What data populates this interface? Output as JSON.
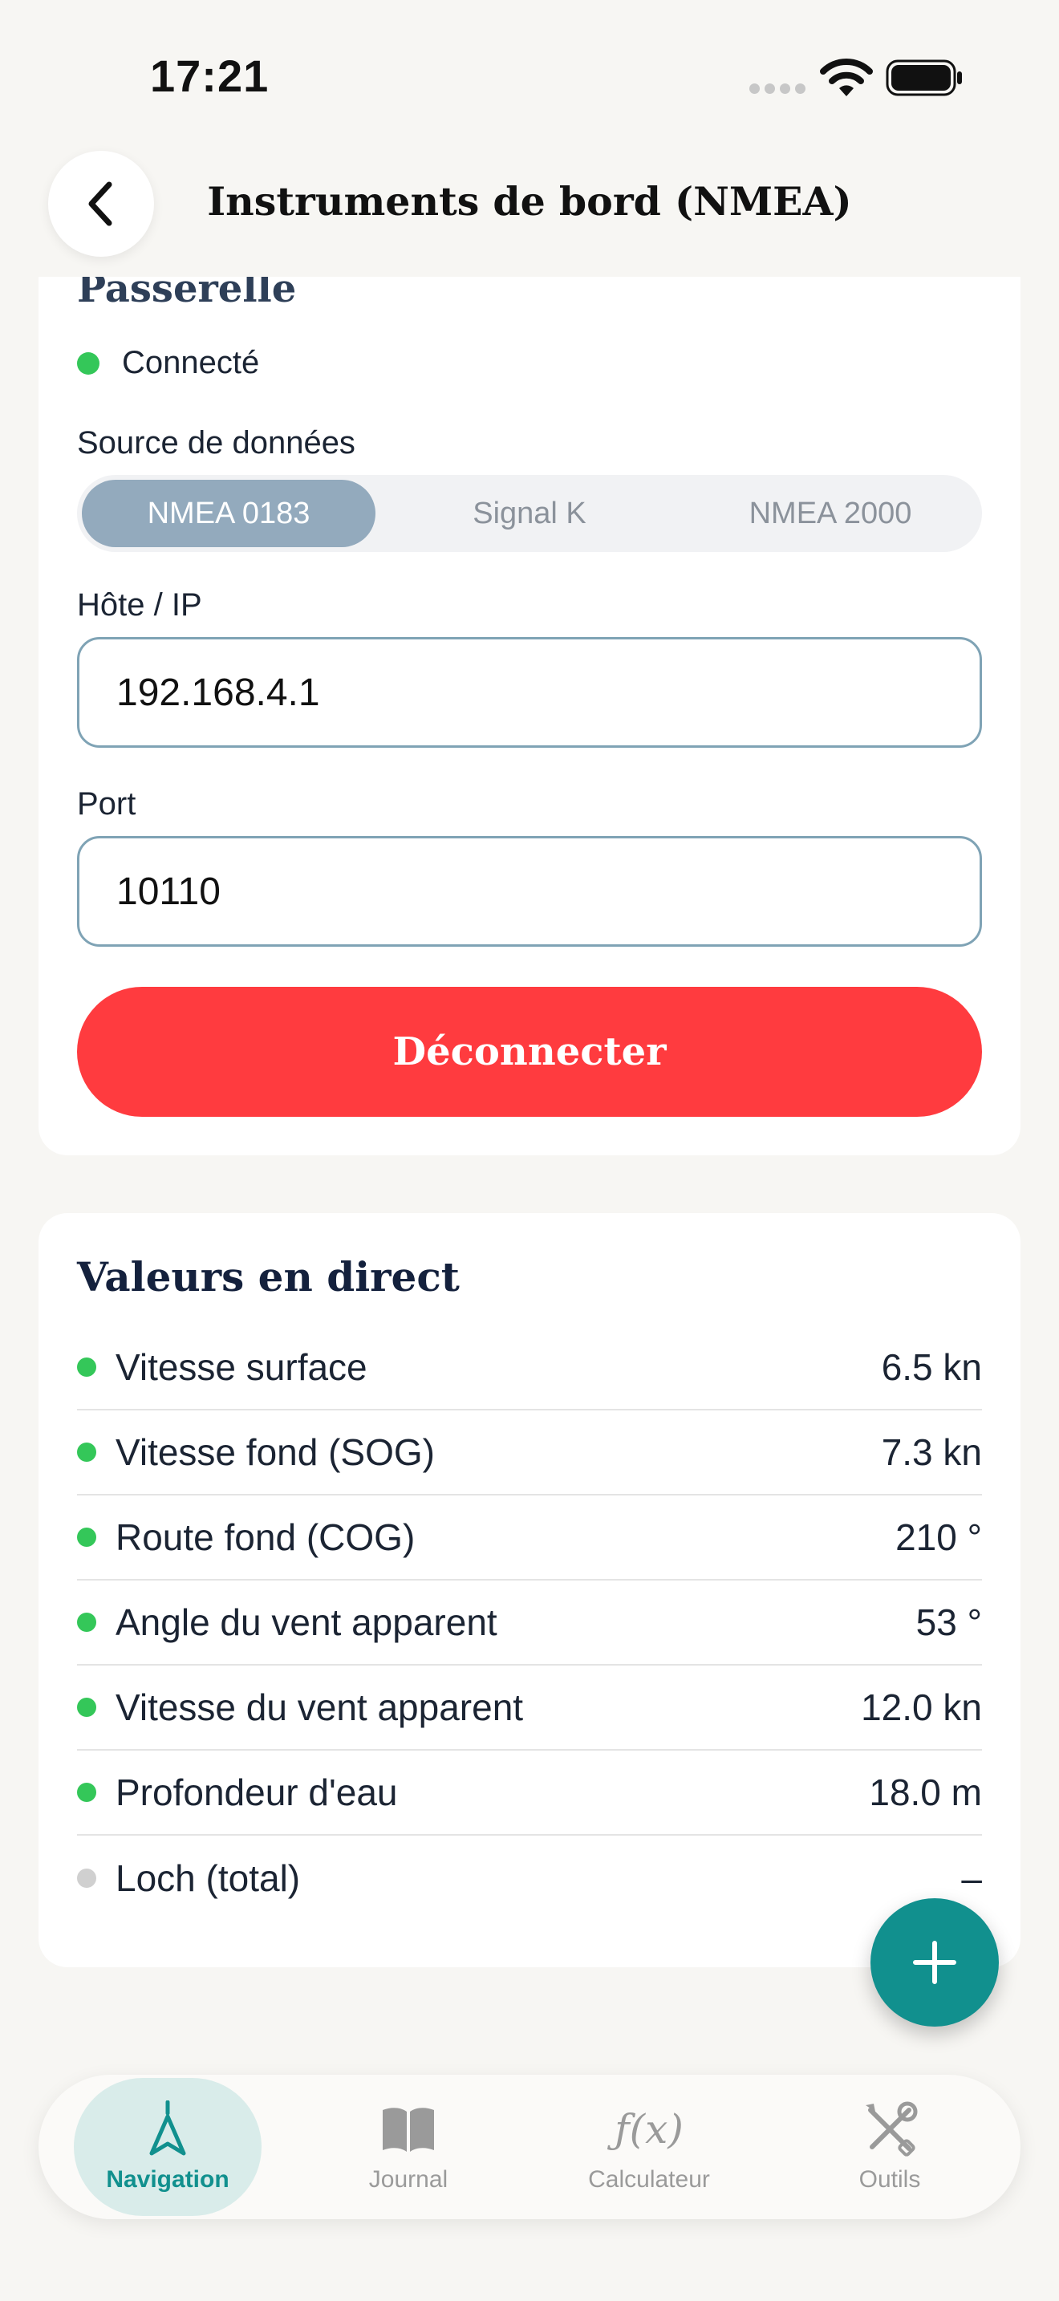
{
  "status": {
    "time": "17:21"
  },
  "header": {
    "title": "Instruments de bord (NMEA)",
    "back_icon": "chevron-left-icon"
  },
  "gateway": {
    "title": "Passerelle",
    "connection_status": "Connecté",
    "connection_color": "#34c759",
    "source_label": "Source de données",
    "sources": [
      "NMEA 0183",
      "Signal K",
      "NMEA 2000"
    ],
    "selected_source": "NMEA 0183",
    "host_label": "Hôte / IP",
    "host_value": "192.168.4.1",
    "port_label": "Port",
    "port_value": "10110",
    "disconnect_label": "Déconnecter",
    "disconnect_color": "#ff3b3f"
  },
  "live": {
    "title": "Valeurs en direct",
    "rows": [
      {
        "label": "Vitesse surface",
        "value": "6.5 kn",
        "active": true
      },
      {
        "label": "Vitesse fond (SOG)",
        "value": "7.3 kn",
        "active": true
      },
      {
        "label": "Route fond (COG)",
        "value": "210 °",
        "active": true
      },
      {
        "label": "Angle du vent apparent",
        "value": "53 °",
        "active": true
      },
      {
        "label": "Vitesse du vent apparent",
        "value": "12.0 kn",
        "active": true
      },
      {
        "label": "Profondeur d'eau",
        "value": "18.0 m",
        "active": true
      },
      {
        "label": "Loch (total)",
        "value": "–",
        "active": false
      }
    ]
  },
  "fab": {
    "icon": "plus-icon",
    "color": "#11908e"
  },
  "tabs": [
    {
      "label": "Navigation",
      "icon": "navigation-arrow-icon",
      "active": true
    },
    {
      "label": "Journal",
      "icon": "book-icon",
      "active": false
    },
    {
      "label": "Calculateur",
      "icon": "function-icon",
      "glyph": "ƒ(x)",
      "active": false
    },
    {
      "label": "Outils",
      "icon": "tools-icon",
      "active": false
    }
  ]
}
